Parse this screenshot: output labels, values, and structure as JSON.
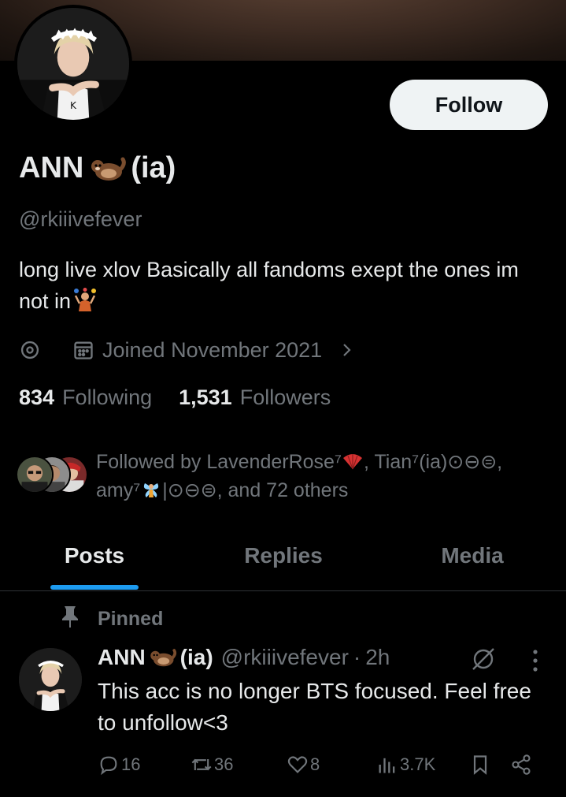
{
  "profile": {
    "display_name_part1": "ANN",
    "display_name_part2": "(ia)",
    "name_emoji": "otter-emoji",
    "handle": "@rkiiivefever",
    "bio_text": "long live xlov Basically all fandoms exept the ones im not in",
    "bio_emoji": "juggler-emoji",
    "joined": "Joined November 2021",
    "following_count": "834",
    "following_label": "Following",
    "followers_count": "1,531",
    "followers_label": "Followers",
    "follow_button": "Follow"
  },
  "followed_by": {
    "prefix": "Followed by LavenderRose⁷",
    "part2": ", Tian⁷(ia)⊙⊖⊜,",
    "part3": "amy⁷",
    "part4": "|⊙⊖⊜, and 72 others"
  },
  "tabs": [
    {
      "label": "Posts",
      "active": true
    },
    {
      "label": "Replies",
      "active": false
    },
    {
      "label": "Media",
      "active": false
    }
  ],
  "pinned_post": {
    "pinned_label": "Pinned",
    "author_name": "ANN",
    "author_suffix": "(ia)",
    "handle": "@rkiiivefever",
    "separator": "·",
    "time": "2h",
    "text": "This acc is no longer BTS focused. Feel free to unfollow<3",
    "replies": "16",
    "reposts": "36",
    "likes": "8",
    "views": "3.7K"
  },
  "colors": {
    "accent": "#1d9bf0",
    "background": "#000000",
    "text_primary": "#e7e9ea",
    "text_secondary": "#71767b"
  }
}
